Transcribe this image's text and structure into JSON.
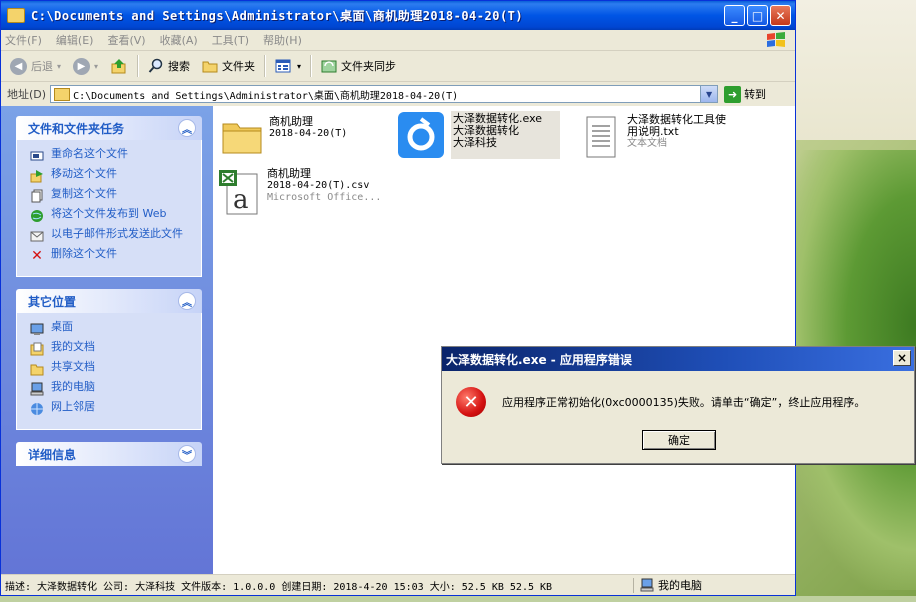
{
  "window": {
    "title": "C:\\Documents and Settings\\Administrator\\桌面\\商机助理2018-04-20(T)",
    "buttons": {
      "min": "_",
      "max": "□",
      "close": "✕"
    }
  },
  "menu": [
    "文件(F)",
    "编辑(E)",
    "查看(V)",
    "收藏(A)",
    "工具(T)",
    "帮助(H)"
  ],
  "toolbar": {
    "back": "后退",
    "search": "搜索",
    "folders": "文件夹",
    "folder_sync": "文件夹同步"
  },
  "address": {
    "label": "地址(D)",
    "value": "C:\\Documents and Settings\\Administrator\\桌面\\商机助理2018-04-20(T)",
    "go": "转到"
  },
  "tasks_panel": {
    "title": "文件和文件夹任务",
    "items": [
      {
        "label": "重命名这个文件",
        "icon": "rename-icon"
      },
      {
        "label": "移动这个文件",
        "icon": "move-icon"
      },
      {
        "label": "复制这个文件",
        "icon": "copy-icon"
      },
      {
        "label": "将这个文件发布到 Web",
        "icon": "web-publish-icon"
      },
      {
        "label": "以电子邮件形式发送此文件",
        "icon": "email-icon"
      },
      {
        "label": "删除这个文件",
        "icon": "delete-icon"
      }
    ]
  },
  "places_panel": {
    "title": "其它位置",
    "items": [
      {
        "label": "桌面",
        "icon": "desktop-icon"
      },
      {
        "label": "我的文档",
        "icon": "my-documents-icon"
      },
      {
        "label": "共享文档",
        "icon": "shared-documents-icon"
      },
      {
        "label": "我的电脑",
        "icon": "my-computer-icon"
      },
      {
        "label": "网上邻居",
        "icon": "network-icon"
      }
    ]
  },
  "details_panel": {
    "title": "详细信息"
  },
  "files": [
    {
      "name": "商机助理",
      "line2": "2018-04-20(T)",
      "line3": "",
      "icon": "folder-icon"
    },
    {
      "name": "大泽数据转化.exe",
      "line2": "大泽数据转化",
      "line3": "大泽科技",
      "icon": "app-icon"
    },
    {
      "name": "大泽数据转化工具使",
      "line2": "用说明.txt",
      "line3": "文本文档",
      "icon": "text-document-icon"
    },
    {
      "name": "商机助理",
      "line2": "2018-04-20(T).csv",
      "line3": "Microsoft Office...",
      "icon": "csv-icon"
    }
  ],
  "status": {
    "text": "描述: 大泽数据转化 公司: 大泽科技 文件版本: 1.0.0.0 创建日期: 2018-4-20 15:03 大小: 52.5 KB 52.5 KB",
    "location": "我的电脑"
  },
  "dialog": {
    "title": "大泽数据转化.exe - 应用程序错误",
    "message": "应用程序正常初始化(0xc0000135)失败。请单击“确定”，终止应用程序。",
    "ok": "确定",
    "close": "×"
  },
  "colors": {
    "title_blue": "#0055e5",
    "task_link": "#215dc6",
    "error_red": "#d41111"
  }
}
